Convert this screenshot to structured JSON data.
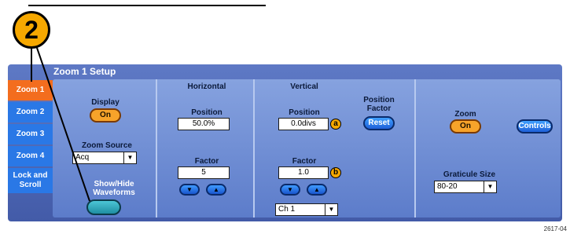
{
  "callout": {
    "number": "2"
  },
  "panel": {
    "title": "Zoom 1 Setup"
  },
  "tabs": [
    {
      "label": "Zoom 1",
      "active": true
    },
    {
      "label": "Zoom 2",
      "active": false
    },
    {
      "label": "Zoom 3",
      "active": false
    },
    {
      "label": "Zoom 4",
      "active": false
    },
    {
      "label": "Lock and Scroll",
      "active": false
    }
  ],
  "display": {
    "label": "Display",
    "button": "On"
  },
  "zoom_source": {
    "label": "Zoom Source",
    "value": "Acq"
  },
  "show_hide": {
    "label": "Show/Hide Waveforms"
  },
  "horizontal": {
    "header": "Horizontal",
    "position_label": "Position",
    "position_value": "50.0%",
    "factor_label": "Factor",
    "factor_value": "5"
  },
  "vertical": {
    "header": "Vertical",
    "position_label": "Position",
    "position_value": "0.0divs",
    "position_badge": "a",
    "factor_label": "Factor",
    "factor_value": "1.0",
    "factor_badge": "b",
    "channel_value": "Ch 1",
    "position_factor_label": "Position Factor",
    "reset_button": "Reset"
  },
  "zoom": {
    "label": "Zoom",
    "button": "On",
    "controls_button": "Controls"
  },
  "graticule": {
    "label": "Graticule Size",
    "value": "80-20"
  },
  "footnote": "2617-04",
  "icons": {
    "arrow_down": "▼",
    "arrow_up": "▲",
    "dropdown": "▼"
  },
  "colors": {
    "accent_orange": "#f36d1e",
    "tab_blue": "#2a78e6",
    "panel_blue": "#5e79c5"
  }
}
